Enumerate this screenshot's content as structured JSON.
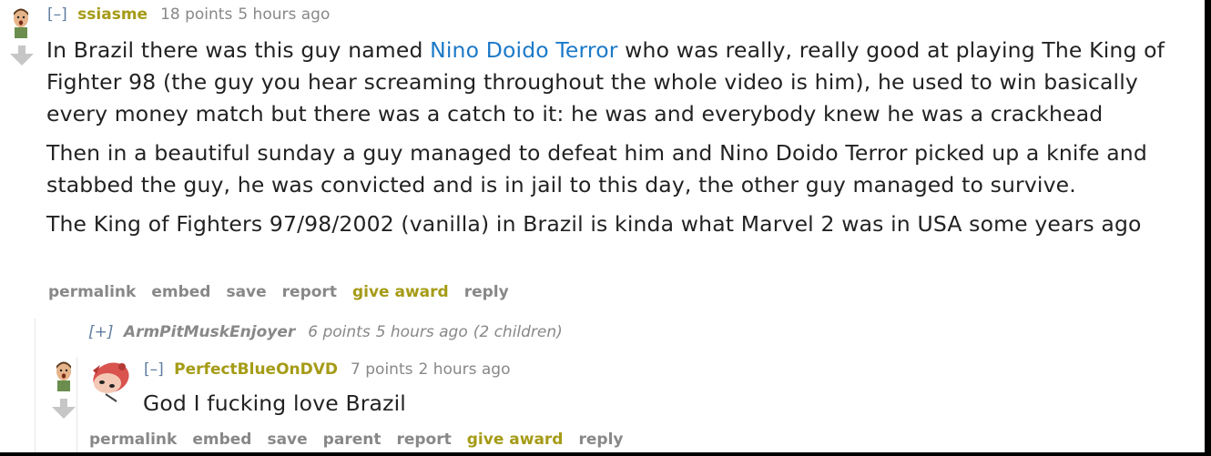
{
  "comment1": {
    "expand": "[–]",
    "author": "ssiasme",
    "score": "18 points",
    "time": "5 hours ago",
    "link_text": "Nino Doido Terror",
    "para1_before": "In Brazil there was this guy named ",
    "para1_after": " who was really, really good at playing The King of Fighter 98 (the guy you hear screaming throughout the whole video is him), he used to win basically every money match but there was a catch to it: he was and everybody knew he was a crackhead",
    "para2": "Then in a beautiful sunday a guy managed to defeat him and Nino Doido Terror picked up a knife and stabbed the guy, he was convicted and is in jail to this day, the other guy managed to survive.",
    "para3": "The King of Fighters 97/98/2002 (vanilla) in Brazil is kinda what Marvel 2 was in USA some years ago",
    "buttons": {
      "permalink": "permalink",
      "embed": "embed",
      "save": "save",
      "report": "report",
      "give_award": "give award",
      "reply": "reply"
    }
  },
  "comment2": {
    "expand": "[+]",
    "author": "ArmPitMuskEnjoyer",
    "score": "6 points",
    "time": "5 hours ago",
    "children": "(2 children)"
  },
  "comment3": {
    "expand": "[–]",
    "author": "PerfectBlueOnDVD",
    "score": "7 points",
    "time": "2 hours ago",
    "body": "God I fucking love Brazil",
    "buttons": {
      "permalink": "permalink",
      "embed": "embed",
      "save": "save",
      "parent": "parent",
      "report": "report",
      "give_award": "give award",
      "reply": "reply"
    }
  },
  "icons": {
    "avatar": "avatar-face-icon",
    "downvote": "downvote-arrow-icon",
    "snoo": "snoo-avatar-icon"
  },
  "colors": {
    "author": "#a59b16",
    "link": "#1b79c7",
    "meta": "#888888"
  }
}
